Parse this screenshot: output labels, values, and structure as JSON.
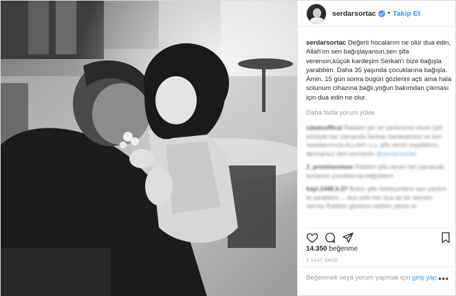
{
  "header": {
    "username": "serdarsortac",
    "separator": "•",
    "follow_label": "Takip Et"
  },
  "caption": {
    "username": "serdarsortac",
    "text": "Değerli hocalarım ne olur dua edin, Allah'ım sen bağışlayansın,sen şifa verensin,küçük kardeşim Serkan'ı bize bağışla yarabbim. Daha 35 yaşında çocuklarına bağışla. Âmin. 15 gün sonra bugün gözlerini açtı ama hala solunum cihazına bağlı,yoğun bakımdan çıkması için dua edin ne olur."
  },
  "load_more_label": "Daha fazla yorum yükle",
  "blurred_comments": [
    {
      "username": "sdadsoffical",
      "text": "Rabbim şer ve yardımcısı olsun (şifi tümüyle her zamanda Serkan kardeşimize ve tüm hastalarımıza ALLAH'ı c.c. şifa versin inşallahım, dermansız dert vermesin",
      "mention": "@serdarsortac"
    },
    {
      "username": "2_promisesmen",
      "text": "Rabbim şifa versin her zamanda kurtarsın çocuklarına bağışlasın",
      "mention": ""
    },
    {
      "username": "kayi.1448.h.27",
      "text": "Bütün gifa bekleyenlere sen yardım et yarabbim ... dua edin her dua de bir semelo varmiş Rabbim gönlünü rabbim yetsin te",
      "mention": ""
    }
  ],
  "likes": {
    "count": "14.350",
    "label": "beğenme"
  },
  "timestamp": "3 SAAT ÖNCE",
  "login_prompt": {
    "text": "Beğenmek veya yorum yapmak için",
    "link": "giriş yap",
    "suffix": ".",
    "more_icon_glyph": "•••"
  },
  "icons": {
    "like": "heart-icon",
    "comment": "comment-icon",
    "share": "share-icon",
    "save": "bookmark-icon"
  },
  "colors": {
    "accent": "#3897f0",
    "text": "#262626",
    "muted": "#999999",
    "border": "#dbdbdb"
  }
}
